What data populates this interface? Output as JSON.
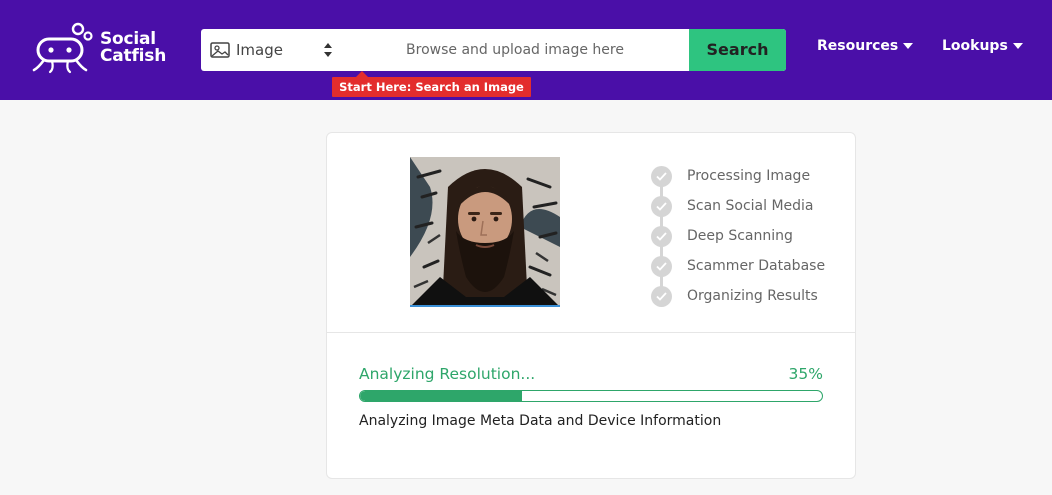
{
  "brand": {
    "line1": "Social",
    "line2": "Catfish"
  },
  "search": {
    "type_label": "Image",
    "placeholder": "Browse and upload image here",
    "button_label": "Search",
    "tooltip": "Start Here: Search an Image"
  },
  "nav": [
    {
      "label": "Resources"
    },
    {
      "label": "Lookups"
    }
  ],
  "steps": [
    {
      "label": "Processing Image"
    },
    {
      "label": "Scan Social Media"
    },
    {
      "label": "Deep Scanning"
    },
    {
      "label": "Scammer Database"
    },
    {
      "label": "Organizing Results"
    }
  ],
  "progress": {
    "status": "Analyzing Resolution...",
    "percent_label": "35%",
    "fraction": 0.35,
    "detail": "Analyzing Image Meta Data and Device Information"
  },
  "colors": {
    "header": "#4a0fa8",
    "search_button": "#2ec480",
    "tooltip": "#e32d2d",
    "progress": "#2ea66a"
  }
}
